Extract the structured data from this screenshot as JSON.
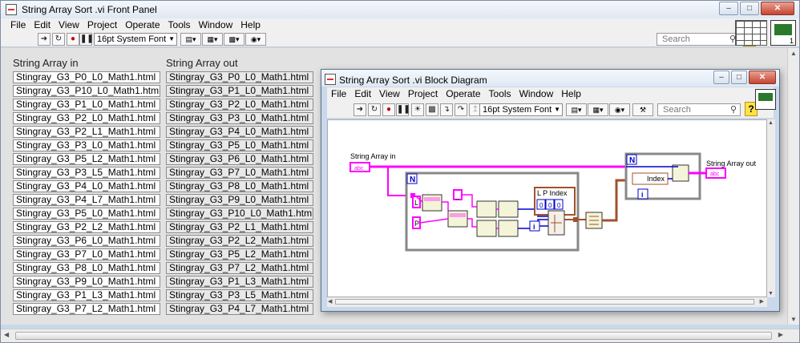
{
  "front_panel": {
    "title": "String Array Sort .vi Front Panel",
    "menu": [
      "File",
      "Edit",
      "View",
      "Project",
      "Operate",
      "Tools",
      "Window",
      "Help"
    ],
    "font_selector": "16pt System Font",
    "search_placeholder": "Search",
    "help_label": "?",
    "array_in": {
      "label": "String Array in",
      "items": [
        "Stingray_G3_P0_L0_Math1.html",
        "Stingray_G3_P10_L0_Math1.html",
        "Stingray_G3_P1_L0_Math1.html",
        "Stingray_G3_P2_L0_Math1.html",
        "Stingray_G3_P2_L1_Math1.html",
        "Stingray_G3_P3_L0_Math1.html",
        "Stingray_G3_P5_L2_Math1.html",
        "Stingray_G3_P3_L5_Math1.html",
        "Stingray_G3_P4_L0_Math1.html",
        "Stingray_G3_P4_L7_Math1.html",
        "Stingray_G3_P5_L0_Math1.html",
        "Stingray_G3_P2_L2_Math1.html",
        "Stingray_G3_P6_L0_Math1.html",
        "Stingray_G3_P7_L0_Math1.html",
        "Stingray_G3_P8_L0_Math1.html",
        "Stingray_G3_P9_L0_Math1.html",
        "Stingray_G3_P1_L3_Math1.html",
        "Stingray_G3_P7_L2_Math1.html"
      ]
    },
    "array_out": {
      "label": "String Array out",
      "items": [
        "Stingray_G3_P0_L0_Math1.html",
        "Stingray_G3_P1_L0_Math1.html",
        "Stingray_G3_P2_L0_Math1.html",
        "Stingray_G3_P3_L0_Math1.html",
        "Stingray_G3_P4_L0_Math1.html",
        "Stingray_G3_P5_L0_Math1.html",
        "Stingray_G3_P6_L0_Math1.html",
        "Stingray_G3_P7_L0_Math1.html",
        "Stingray_G3_P8_L0_Math1.html",
        "Stingray_G3_P9_L0_Math1.html",
        "Stingray_G3_P10_L0_Math1.html",
        "Stingray_G3_P2_L1_Math1.html",
        "Stingray_G3_P2_L2_Math1.html",
        "Stingray_G3_P5_L2_Math1.html",
        "Stingray_G3_P7_L2_Math1.html",
        "Stingray_G3_P1_L3_Math1.html",
        "Stingray_G3_P3_L5_Math1.html",
        "Stingray_G3_P4_L7_Math1.html"
      ]
    }
  },
  "block_diagram": {
    "title": "String Array Sort .vi Block Diagram",
    "menu": [
      "File",
      "Edit",
      "View",
      "Project",
      "Operate",
      "Tools",
      "Window",
      "Help"
    ],
    "font_selector": "16pt System Font",
    "search_placeholder": "Search",
    "help_label": "?",
    "labels": {
      "array_in": "String Array in",
      "array_out": "String Array out",
      "cluster": "L  P  Index",
      "index": "Index",
      "n": "N",
      "i": "i",
      "l": "L",
      "p": "P",
      "abc": "abc",
      "zero": "0"
    }
  },
  "colors": {
    "string_wire": "#ff00ff",
    "int_wire": "#0000cc",
    "cluster_wire": "#a0522d",
    "window_frame": "#c9d8ea"
  }
}
